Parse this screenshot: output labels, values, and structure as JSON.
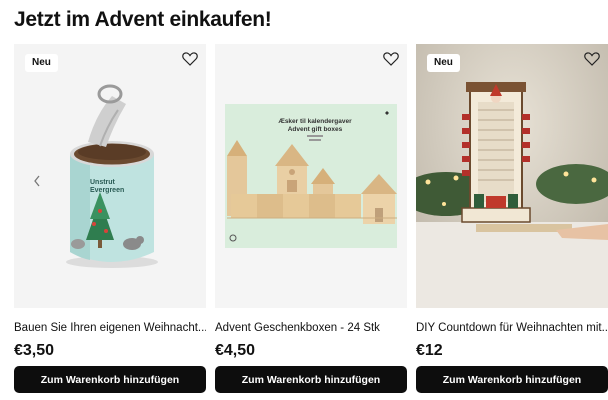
{
  "page": {
    "heading": "Jetzt im Advent einkaufen!"
  },
  "colors": {
    "button_bg": "#0d0d0d",
    "button_text": "#ffffff",
    "badge_bg": "#ffffff"
  },
  "products": [
    {
      "badge": "Neu",
      "title": "Bauen Sie Ihren eigenen Weihnacht...",
      "price": "€3,50",
      "cart_label": "Zum Warenkorb hinzufügen",
      "image_text": [
        "Unstrut",
        "Evergreen"
      ],
      "icons": [
        "heart-icon",
        "chevron-left-icon"
      ]
    },
    {
      "badge": "",
      "title": "Advent Geschenkboxen - 24 Stk",
      "price": "€4,50",
      "cart_label": "Zum Warenkorb hinzufügen",
      "image_text": [
        "Æsker til kalendergaver",
        "Advent gift boxes"
      ],
      "icons": [
        "heart-icon"
      ]
    },
    {
      "badge": "Neu",
      "title": "DIY Countdown für Weihnachten mit...",
      "price": "€12",
      "cart_label": "Zum Warenkorb hinzufügen",
      "image_text": [],
      "icons": [
        "heart-icon"
      ]
    }
  ]
}
